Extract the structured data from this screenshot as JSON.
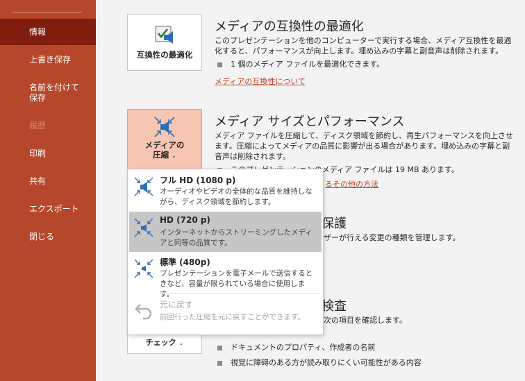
{
  "sidebar": {
    "items": [
      {
        "label": "情報",
        "state": "active"
      },
      {
        "label": "上書き保存",
        "state": "normal"
      },
      {
        "label": "名前を付けて保存",
        "state": "normal"
      },
      {
        "label": "履歴",
        "state": "disabled"
      },
      {
        "label": "印刷",
        "state": "normal"
      },
      {
        "label": "共有",
        "state": "normal"
      },
      {
        "label": "エクスポート",
        "state": "normal"
      },
      {
        "label": "閉じる",
        "state": "normal"
      }
    ]
  },
  "compat": {
    "button_label": "互換性の最適化",
    "title": "メディアの互換性の最適化",
    "desc": "このプレゼンテーションを他のコンピューターで実行する場合、メディア互換性を最適化すると、パフォーマンスが向上します。埋め込みの字幕と副音声は削除されます。",
    "bullet": "1 個のメディア ファイルを最適化できます。",
    "link": "メディアの互換性について"
  },
  "media": {
    "button_label_line1": "メディアの",
    "button_label_line2": "圧縮",
    "title": "メディア サイズとパフォーマンス",
    "desc": "メディア ファイルを圧縮して、ディスク領域を節約し、再生パフォーマンスを向上させます。圧縮によってメディアの品質に影響が出る場合があります。埋め込みの字幕と副音声は削除されます。",
    "bullet": "このプレゼンテーションのメディア ファイルは 19 MB あります。",
    "link": "るその他の方法"
  },
  "protect": {
    "title_fragment": "保護",
    "desc_fragment": "ザーが行える変更の種類を管理します。"
  },
  "inspect": {
    "title_fragment": "検査",
    "desc_fragment": "次の項目を確認します。",
    "button_label": "チェック",
    "bullets": [
      "ドキュメントのプロパティ、作成者の名前",
      "視覚に障碍のある方が読み取りにくい可能性がある内容"
    ]
  },
  "dropdown": {
    "options": [
      {
        "title": "フル HD (1080 p)",
        "desc": "オーディオやビデオの全体的な品質を維持しながら、ディスク領域を節約します。",
        "state": "normal"
      },
      {
        "title": "HD (720 p)",
        "desc": "インターネットからストリーミングしたメディアと同等の品質です。",
        "state": "hover"
      },
      {
        "title": "標準 (480p)",
        "desc": "プレゼンテーションを電子メールで送信するときなど、容量が限られている場合に使用します。",
        "state": "normal"
      },
      {
        "title": "元に戻す",
        "desc": "前回行った圧縮を元に戻すことができます。",
        "state": "disabled"
      }
    ]
  },
  "colors": {
    "sidebar_bg": "#b7472a",
    "sidebar_active": "#7f1d0f",
    "link": "#c43e1c",
    "hot_button": "#f7c6b2",
    "hover_option": "#c6c6c6"
  }
}
